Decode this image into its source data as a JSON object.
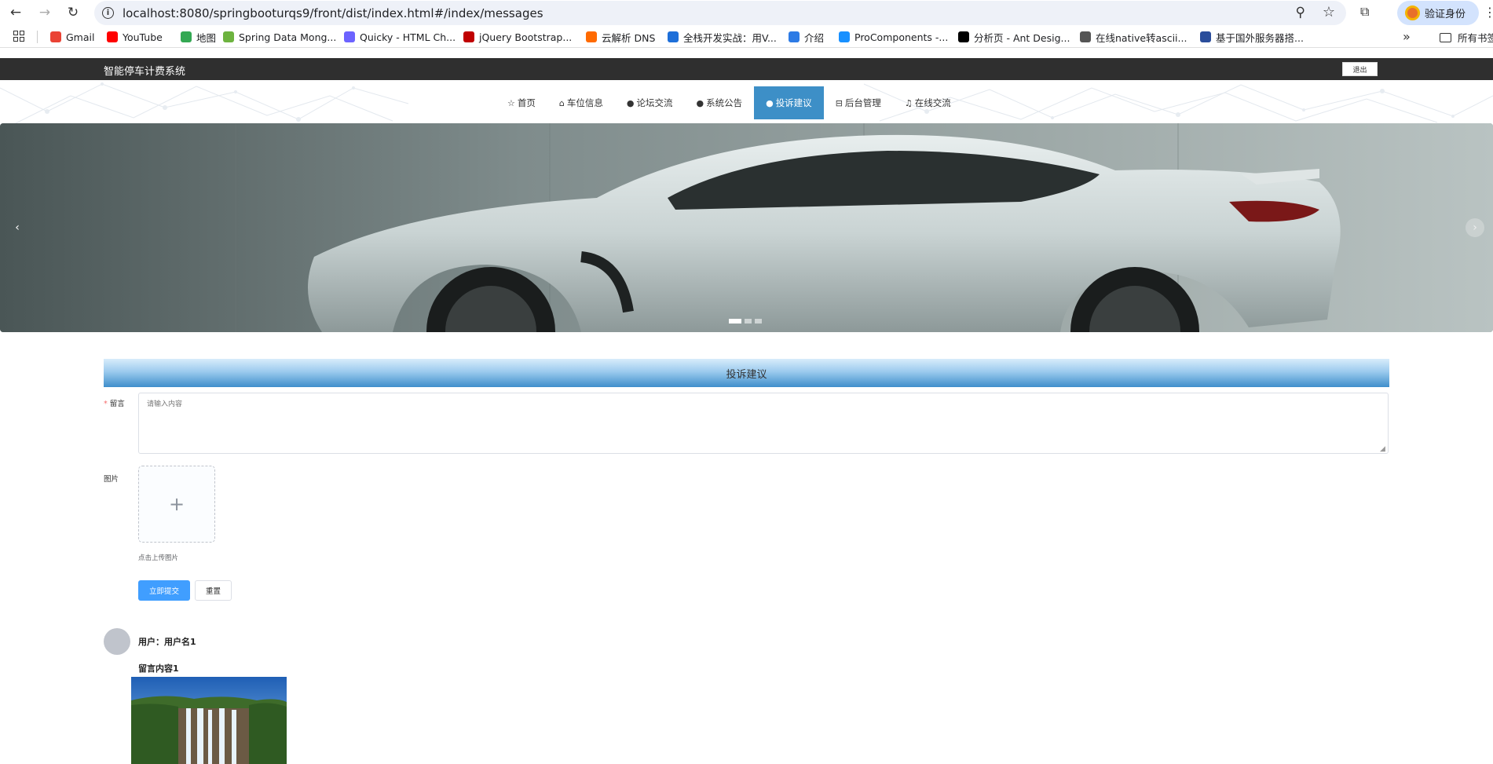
{
  "browser": {
    "url": "localhost:8080/springbooturqs9/front/dist/index.html#/index/messages",
    "profile_label": "验证身份",
    "bookmarks": [
      {
        "label": "Gmail",
        "color": "#ea4335"
      },
      {
        "label": "YouTube",
        "color": "#ff0000"
      },
      {
        "label": "地图",
        "color": "#34a853"
      },
      {
        "label": "Spring Data Mong...",
        "color": "#6db33f"
      },
      {
        "label": "Quicky - HTML Ch...",
        "color": "#6c63ff"
      },
      {
        "label": "jQuery Bootstrap...",
        "color": "#c00000"
      },
      {
        "label": "云解析 DNS",
        "color": "#ff6a00"
      },
      {
        "label": "全栈开发实战：用V...",
        "color": "#1e6fd9"
      },
      {
        "label": "介绍",
        "color": "#2d7be5"
      },
      {
        "label": "ProComponents -...",
        "color": "#1890ff"
      },
      {
        "label": "分析页 - Ant Desig...",
        "color": "#000000"
      },
      {
        "label": "在线native转ascii...",
        "color": "#555555"
      },
      {
        "label": "基于国外服务器搭...",
        "color": "#2a4d9b"
      }
    ],
    "all_bookmarks_label": "所有书签"
  },
  "site": {
    "title": "智能停车计费系统",
    "logout_label": "退出"
  },
  "nav": {
    "items": [
      {
        "label": "首页",
        "icon": "☆"
      },
      {
        "label": "车位信息",
        "icon": "⌂"
      },
      {
        "label": "论坛交流",
        "icon": "●"
      },
      {
        "label": "系统公告",
        "icon": "●"
      },
      {
        "label": "投诉建议",
        "icon": "●"
      },
      {
        "label": "后台管理",
        "icon": "⊟"
      },
      {
        "label": "在线交流",
        "icon": "♫"
      }
    ],
    "active_index": 4,
    "active_color": "#3d8fc7"
  },
  "carousel": {
    "prev": "‹",
    "next": "›",
    "slide_count": 3,
    "active_slide": 0
  },
  "section": {
    "title": "投诉建议"
  },
  "form": {
    "message_label": "留言",
    "message_placeholder": "请输入内容",
    "image_label": "图片",
    "upload_plus": "+",
    "upload_tip": "点击上传图片",
    "submit_label": "立即提交",
    "reset_label": "重置",
    "primary_color": "#409eff"
  },
  "messages": [
    {
      "user_text": "用户：用户名1",
      "content": "留言内容1"
    }
  ]
}
